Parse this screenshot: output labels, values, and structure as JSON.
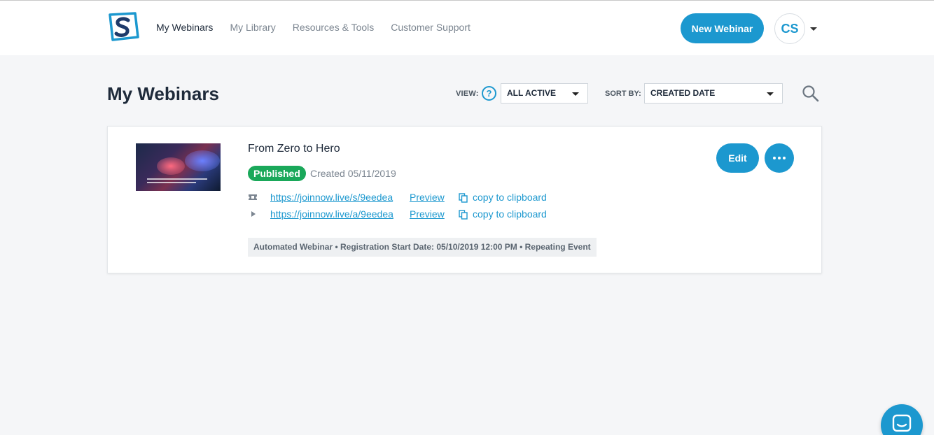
{
  "nav": {
    "items": [
      {
        "label": "My Webinars",
        "active": true
      },
      {
        "label": "My Library",
        "active": false
      },
      {
        "label": "Resources & Tools",
        "active": false
      },
      {
        "label": "Customer Support",
        "active": false
      }
    ],
    "new_webinar_label": "New Webinar",
    "avatar_initials": "CS"
  },
  "header": {
    "title": "My Webinars",
    "view_label": "VIEW:",
    "view_value": "ALL ACTIVE",
    "sort_label": "SORT BY:",
    "sort_value": "CREATED DATE"
  },
  "webinars": [
    {
      "title": "From Zero to Hero",
      "status": "Published",
      "created": "Created 05/11/2019",
      "links": [
        {
          "icon": "ticket-icon",
          "url": "https://joinnow.live/s/9eedea",
          "preview": "Preview",
          "copy": "copy to clipboard"
        },
        {
          "icon": "play-icon",
          "url": "https://joinnow.live/a/9eedea",
          "preview": "Preview",
          "copy": "copy to clipboard"
        }
      ],
      "meta": "Automated Webinar • Registration Start Date: 05/10/2019 12:00 PM • Repeating Event",
      "edit_label": "Edit"
    }
  ],
  "colors": {
    "accent": "#1c98cf",
    "published": "#1aa85a",
    "background": "#f5f6f8"
  }
}
